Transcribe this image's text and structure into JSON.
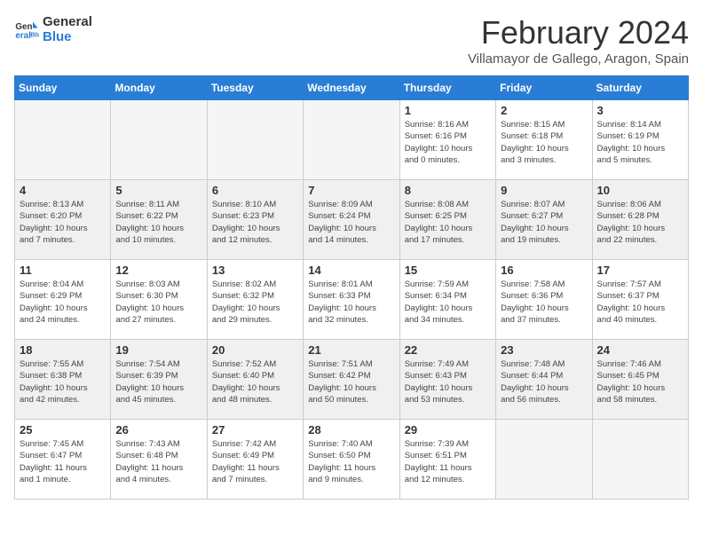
{
  "logo": {
    "line1": "General",
    "line2": "Blue"
  },
  "title": "February 2024",
  "subtitle": "Villamayor de Gallego, Aragon, Spain",
  "days_of_week": [
    "Sunday",
    "Monday",
    "Tuesday",
    "Wednesday",
    "Thursday",
    "Friday",
    "Saturday"
  ],
  "weeks": [
    [
      {
        "day": "",
        "info": "",
        "empty": true
      },
      {
        "day": "",
        "info": "",
        "empty": true
      },
      {
        "day": "",
        "info": "",
        "empty": true
      },
      {
        "day": "",
        "info": "",
        "empty": true
      },
      {
        "day": "1",
        "info": "Sunrise: 8:16 AM\nSunset: 6:16 PM\nDaylight: 10 hours\nand 0 minutes.",
        "empty": false
      },
      {
        "day": "2",
        "info": "Sunrise: 8:15 AM\nSunset: 6:18 PM\nDaylight: 10 hours\nand 3 minutes.",
        "empty": false
      },
      {
        "day": "3",
        "info": "Sunrise: 8:14 AM\nSunset: 6:19 PM\nDaylight: 10 hours\nand 5 minutes.",
        "empty": false
      }
    ],
    [
      {
        "day": "4",
        "info": "Sunrise: 8:13 AM\nSunset: 6:20 PM\nDaylight: 10 hours\nand 7 minutes.",
        "empty": false
      },
      {
        "day": "5",
        "info": "Sunrise: 8:11 AM\nSunset: 6:22 PM\nDaylight: 10 hours\nand 10 minutes.",
        "empty": false
      },
      {
        "day": "6",
        "info": "Sunrise: 8:10 AM\nSunset: 6:23 PM\nDaylight: 10 hours\nand 12 minutes.",
        "empty": false
      },
      {
        "day": "7",
        "info": "Sunrise: 8:09 AM\nSunset: 6:24 PM\nDaylight: 10 hours\nand 14 minutes.",
        "empty": false
      },
      {
        "day": "8",
        "info": "Sunrise: 8:08 AM\nSunset: 6:25 PM\nDaylight: 10 hours\nand 17 minutes.",
        "empty": false
      },
      {
        "day": "9",
        "info": "Sunrise: 8:07 AM\nSunset: 6:27 PM\nDaylight: 10 hours\nand 19 minutes.",
        "empty": false
      },
      {
        "day": "10",
        "info": "Sunrise: 8:06 AM\nSunset: 6:28 PM\nDaylight: 10 hours\nand 22 minutes.",
        "empty": false
      }
    ],
    [
      {
        "day": "11",
        "info": "Sunrise: 8:04 AM\nSunset: 6:29 PM\nDaylight: 10 hours\nand 24 minutes.",
        "empty": false
      },
      {
        "day": "12",
        "info": "Sunrise: 8:03 AM\nSunset: 6:30 PM\nDaylight: 10 hours\nand 27 minutes.",
        "empty": false
      },
      {
        "day": "13",
        "info": "Sunrise: 8:02 AM\nSunset: 6:32 PM\nDaylight: 10 hours\nand 29 minutes.",
        "empty": false
      },
      {
        "day": "14",
        "info": "Sunrise: 8:01 AM\nSunset: 6:33 PM\nDaylight: 10 hours\nand 32 minutes.",
        "empty": false
      },
      {
        "day": "15",
        "info": "Sunrise: 7:59 AM\nSunset: 6:34 PM\nDaylight: 10 hours\nand 34 minutes.",
        "empty": false
      },
      {
        "day": "16",
        "info": "Sunrise: 7:58 AM\nSunset: 6:36 PM\nDaylight: 10 hours\nand 37 minutes.",
        "empty": false
      },
      {
        "day": "17",
        "info": "Sunrise: 7:57 AM\nSunset: 6:37 PM\nDaylight: 10 hours\nand 40 minutes.",
        "empty": false
      }
    ],
    [
      {
        "day": "18",
        "info": "Sunrise: 7:55 AM\nSunset: 6:38 PM\nDaylight: 10 hours\nand 42 minutes.",
        "empty": false
      },
      {
        "day": "19",
        "info": "Sunrise: 7:54 AM\nSunset: 6:39 PM\nDaylight: 10 hours\nand 45 minutes.",
        "empty": false
      },
      {
        "day": "20",
        "info": "Sunrise: 7:52 AM\nSunset: 6:40 PM\nDaylight: 10 hours\nand 48 minutes.",
        "empty": false
      },
      {
        "day": "21",
        "info": "Sunrise: 7:51 AM\nSunset: 6:42 PM\nDaylight: 10 hours\nand 50 minutes.",
        "empty": false
      },
      {
        "day": "22",
        "info": "Sunrise: 7:49 AM\nSunset: 6:43 PM\nDaylight: 10 hours\nand 53 minutes.",
        "empty": false
      },
      {
        "day": "23",
        "info": "Sunrise: 7:48 AM\nSunset: 6:44 PM\nDaylight: 10 hours\nand 56 minutes.",
        "empty": false
      },
      {
        "day": "24",
        "info": "Sunrise: 7:46 AM\nSunset: 6:45 PM\nDaylight: 10 hours\nand 58 minutes.",
        "empty": false
      }
    ],
    [
      {
        "day": "25",
        "info": "Sunrise: 7:45 AM\nSunset: 6:47 PM\nDaylight: 11 hours\nand 1 minute.",
        "empty": false
      },
      {
        "day": "26",
        "info": "Sunrise: 7:43 AM\nSunset: 6:48 PM\nDaylight: 11 hours\nand 4 minutes.",
        "empty": false
      },
      {
        "day": "27",
        "info": "Sunrise: 7:42 AM\nSunset: 6:49 PM\nDaylight: 11 hours\nand 7 minutes.",
        "empty": false
      },
      {
        "day": "28",
        "info": "Sunrise: 7:40 AM\nSunset: 6:50 PM\nDaylight: 11 hours\nand 9 minutes.",
        "empty": false
      },
      {
        "day": "29",
        "info": "Sunrise: 7:39 AM\nSunset: 6:51 PM\nDaylight: 11 hours\nand 12 minutes.",
        "empty": false
      },
      {
        "day": "",
        "info": "",
        "empty": true
      },
      {
        "day": "",
        "info": "",
        "empty": true
      }
    ]
  ]
}
